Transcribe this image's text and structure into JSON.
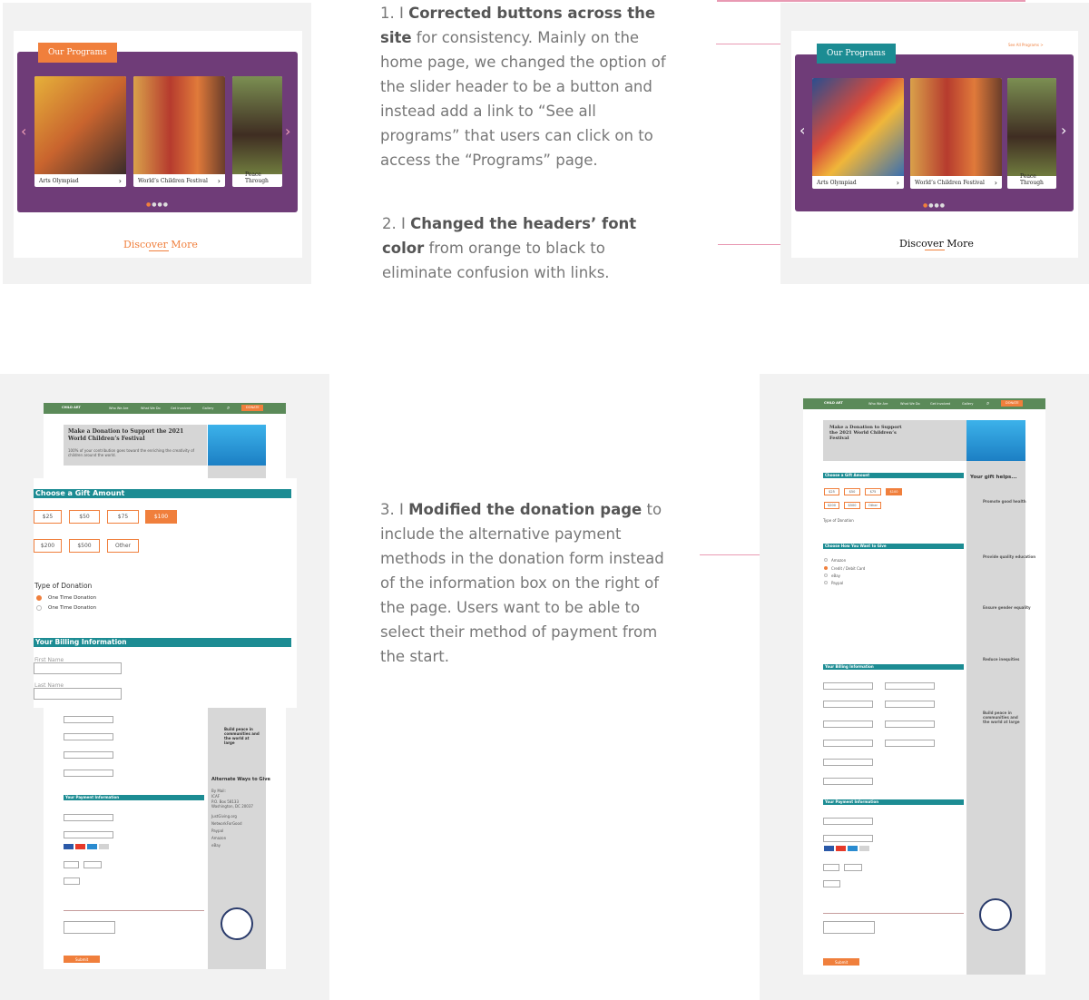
{
  "notes": [
    {
      "num": "1. I ",
      "bold": "Corrected buttons across the site",
      "rest": " for consistency. Mainly on the home page, we changed the option of the slider header  to be a button and instead add a link to “See all programs” that users can click on to access the “Programs” page."
    },
    {
      "num": "2. I ",
      "bold": "Changed the headers’ font color",
      "rest": " from orange to black to eliminate confusion with links."
    },
    {
      "num": "3. I ",
      "bold": "Modified the donation page",
      "rest": " to include the alternative payment methods in the donation form instead of the information box on the right of the page. Users want to be able to select their method of payment from the start."
    }
  ],
  "before_slider": {
    "tag": "Our Programs",
    "slides": [
      "Arts Olympiad",
      "World’s Children Festival",
      "Peace Through"
    ],
    "discover": "Discover More"
  },
  "after_slider": {
    "tag": "Our Programs",
    "see_all": "See All Programs  >",
    "slides": [
      "Arts Olympiad",
      "World’s Children Festival",
      "Peace Through"
    ],
    "discover": "Discover More"
  },
  "colors": {
    "purple": "#6f3c78",
    "orange": "#f07f3c",
    "teal": "#1c8c93",
    "green": "#5b8a59",
    "pink": "#e99ab3"
  },
  "before_donation": {
    "nav": [
      "Who We Are",
      "What We Do",
      "Get Involved",
      "Gallery"
    ],
    "donate": "DONATE",
    "title": "Make a Donation to Support the 2021 World Children’s Festival",
    "sub": "100% of your contribution goes toward the enriching the creativity of children around the world.",
    "gift_header": "Choose a Gift Amount",
    "amounts": [
      "$25",
      "$50",
      "$75",
      "$100",
      "$200",
      "$500",
      "Other"
    ],
    "type_label": "Type of Donation",
    "type_options": [
      "One Time Donation",
      "One Time Donation"
    ],
    "billing_header": "Your Billing Information",
    "first": "First Name",
    "last": "Last Name",
    "payment_header": "Your Payment Information",
    "alt_header": "Alternate Ways to Give",
    "alt_items": [
      "By Mail:",
      "ICAF",
      "P.O. Box 58133",
      "Washington, DC 20037",
      "JustGiving.org",
      "NetworkForGood",
      "Paypal",
      "Amazon",
      "eBay"
    ],
    "build_peace": "Build peace in communities and the world at large",
    "submit": "Submit"
  },
  "after_donation": {
    "gift_header": "Choose a Gift Amount",
    "how_header": "Choose How You Want to Give",
    "how_options": [
      "Amazon",
      "Credit / Debit Card",
      "eBay",
      "Paypal"
    ],
    "billing_header": "Your Billing Information",
    "payment_header": "Your Payment Information",
    "sidebar_title": "Your gift helps...",
    "sidebar_items": [
      "Promote good health",
      "Provide quality education",
      "Ensure gender equality",
      "Reduce inequities",
      "Build peace in communities and the world at large"
    ],
    "submit": "Submit"
  }
}
